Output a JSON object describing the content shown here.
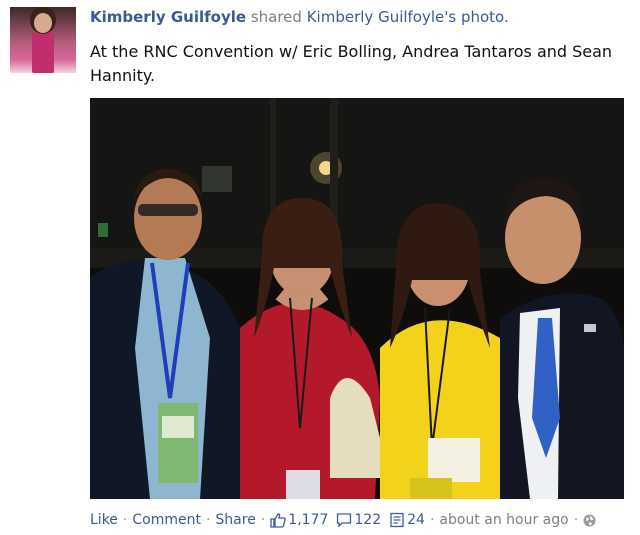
{
  "post": {
    "author": "Kimberly Guilfoyle",
    "action": "shared",
    "shared_link": "Kimberly Guilfoyle's photo.",
    "message": "At the RNC Convention w/ Eric Bolling, Andrea Tantaros and Sean Hannity."
  },
  "actions": {
    "like": "Like",
    "comment": "Comment",
    "share": "Share",
    "likes_count": "1,177",
    "comments_count": "122",
    "shares_count": "24",
    "timestamp": "about an hour ago",
    "icons": {
      "likes": "thumbs-up-icon",
      "comments": "comment-icon",
      "shares": "share-icon",
      "privacy": "globe-icon"
    }
  },
  "colors": {
    "link": "#3b5998",
    "meta": "#7f7f7f",
    "dress_red": "#b3192a",
    "dress_yellow": "#f2d21a"
  }
}
